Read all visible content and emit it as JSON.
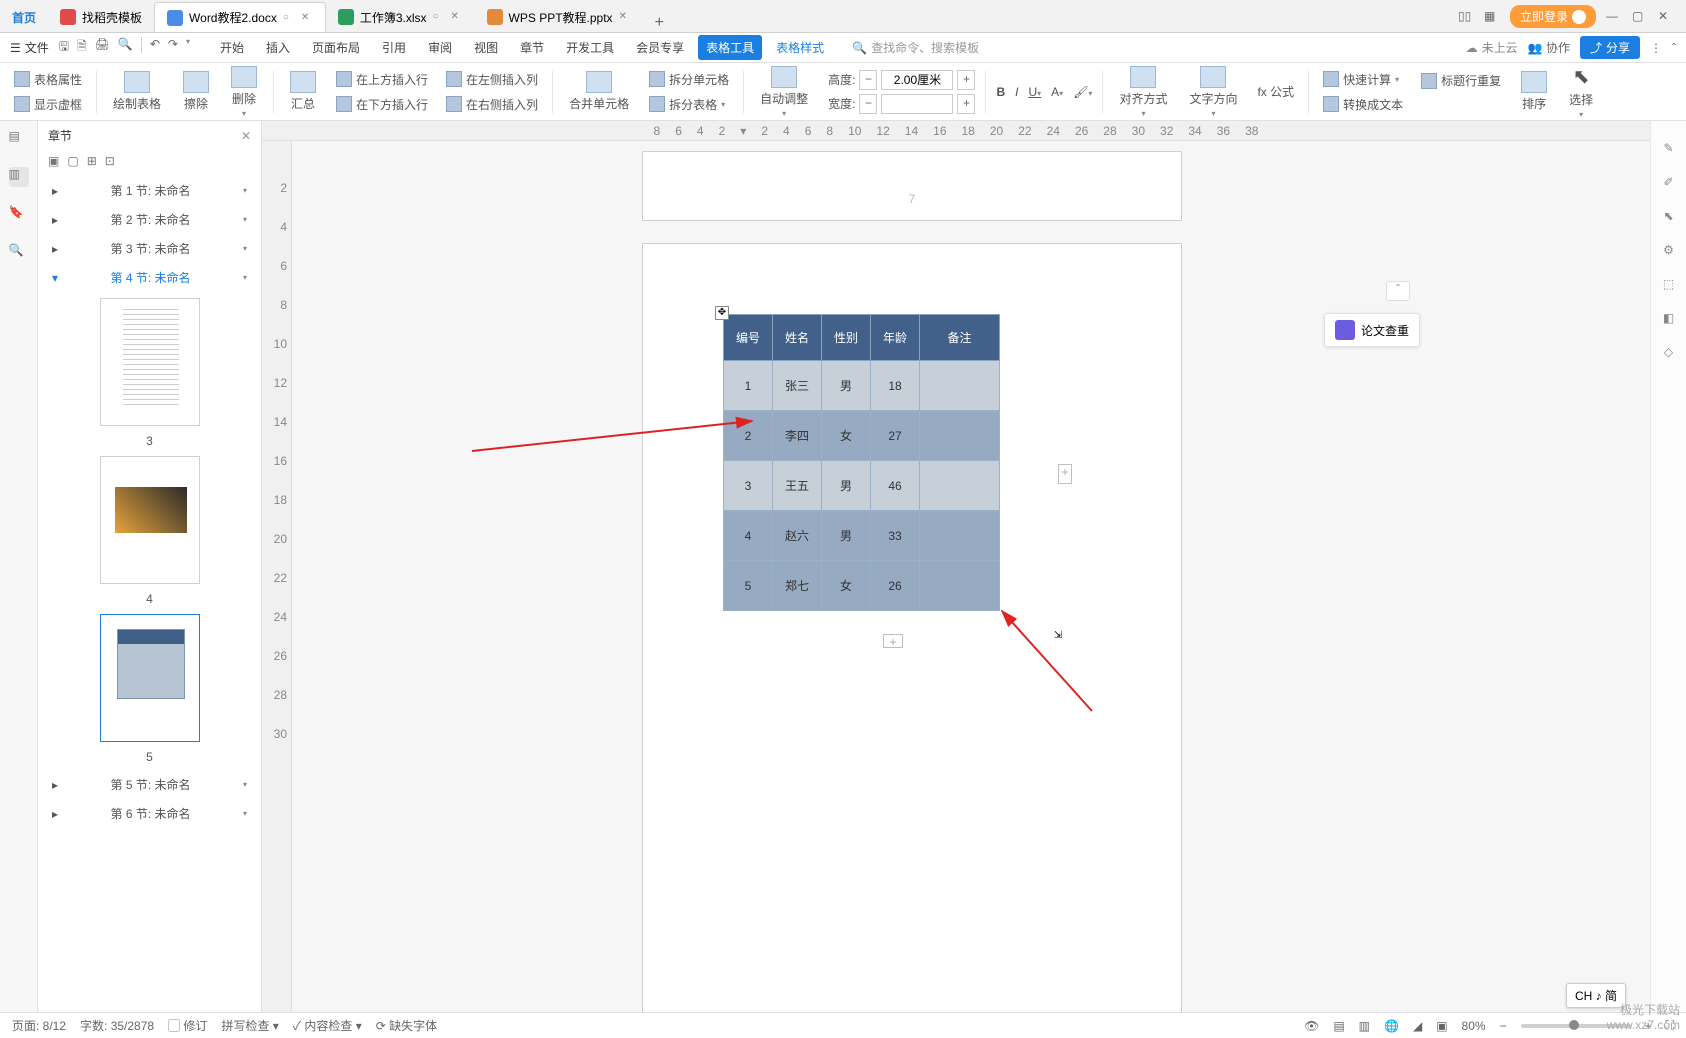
{
  "tabs": {
    "home": "首页",
    "docai": "找稻壳模板",
    "doc1": "Word教程2.docx",
    "doc2": "工作簿3.xlsx",
    "doc3": "WPS PPT教程.pptx"
  },
  "window": {
    "login": "立即登录"
  },
  "menu": {
    "file": "文件",
    "items": [
      "开始",
      "插入",
      "页面布局",
      "引用",
      "审阅",
      "视图",
      "章节",
      "开发工具",
      "会员专享",
      "表格工具",
      "表格样式"
    ],
    "search_placeholder": "查找命令、搜索模板",
    "cloud": "未上云",
    "coop": "协作",
    "share": "分享"
  },
  "ribbon": {
    "tblprops": "表格属性",
    "showlines": "显示虚框",
    "drawtable": "绘制表格",
    "eraser": "擦除",
    "delete": "删除",
    "summary": "汇总",
    "ins_above": "在上方插入行",
    "ins_below": "在下方插入行",
    "ins_left": "在左侧插入列",
    "ins_right": "在右侧插入列",
    "merge": "合并单元格",
    "split": "拆分单元格",
    "split_table": "拆分表格",
    "autofit": "自动调整",
    "height_lbl": "高度:",
    "height_val": "2.00厘米",
    "width_lbl": "宽度:",
    "width_val": "",
    "align": "对齐方式",
    "textdir": "文字方向",
    "formula": "fx 公式",
    "quickcalc": "快速计算",
    "headerrepeat": "标题行重复",
    "totext": "转换成文本",
    "sort": "排序",
    "select": "选择"
  },
  "sidepanel": {
    "title": "章节",
    "nodes": [
      {
        "label": "第 1 节: 未命名"
      },
      {
        "label": "第 2 节: 未命名"
      },
      {
        "label": "第 3 节: 未命名"
      },
      {
        "label": "第 4 节: 未命名"
      },
      {
        "label": "第 5 节: 未命名"
      },
      {
        "label": "第 6 节: 未命名"
      }
    ],
    "thumbs": [
      "3",
      "4",
      "5"
    ]
  },
  "document": {
    "headers": [
      "编号",
      "姓名",
      "性别",
      "年龄",
      "备注"
    ],
    "rows": [
      [
        "1",
        "张三",
        "男",
        "18",
        ""
      ],
      [
        "2",
        "李四",
        "女",
        "27",
        ""
      ],
      [
        "3",
        "王五",
        "男",
        "46",
        ""
      ],
      [
        "4",
        "赵六",
        "男",
        "33",
        ""
      ],
      [
        "5",
        "郑七",
        "女",
        "26",
        ""
      ]
    ],
    "prevfooter": "7"
  },
  "floatpanel": {
    "label": "论文查重"
  },
  "statusbar": {
    "page": "页面: 8/12",
    "words": "字数: 35/2878",
    "track": "修订",
    "spell": "拼写检查",
    "content": "内容检查",
    "fontmiss": "缺失字体",
    "zoom": "80%"
  },
  "ime": "CH ♪ 简",
  "watermark": {
    "l1": "极光下载站",
    "l2": "www.xz7.com"
  }
}
